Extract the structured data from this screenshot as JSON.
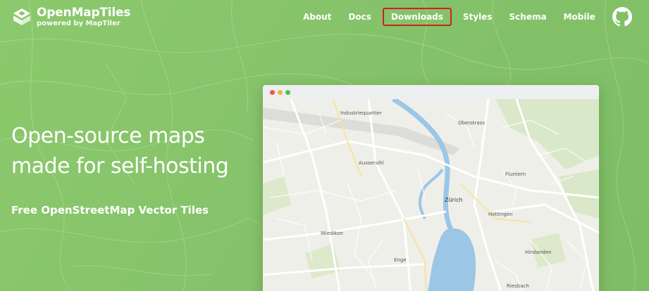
{
  "brand": {
    "title": "OpenMapTiles",
    "subtitle": "powered by MapTiler"
  },
  "nav": {
    "items": [
      "About",
      "Docs",
      "Downloads",
      "Styles",
      "Schema",
      "Mobile"
    ],
    "highlighted": "Downloads"
  },
  "hero": {
    "title_line1": "Open-source maps",
    "title_line2": "made for self-hosting",
    "subtitle": "Free OpenStreetMap Vector Tiles"
  },
  "map_preview": {
    "labels": {
      "industriequartier": "Industriequartier",
      "oberstrass": "Oberstrass",
      "aussersihl": "Aussersihl",
      "fluntern": "Fluntern",
      "zurich": "Zürich",
      "hottingen": "Hottingen",
      "wiedikon": "Wiedikon",
      "hirslanden": "Hirslanden",
      "enge": "Enge",
      "riesbach": "Riesbach"
    }
  },
  "colors": {
    "background": "#86c36a",
    "highlight_border": "#d0201f",
    "water": "#9cc6e6",
    "park": "#d7e7c7"
  }
}
